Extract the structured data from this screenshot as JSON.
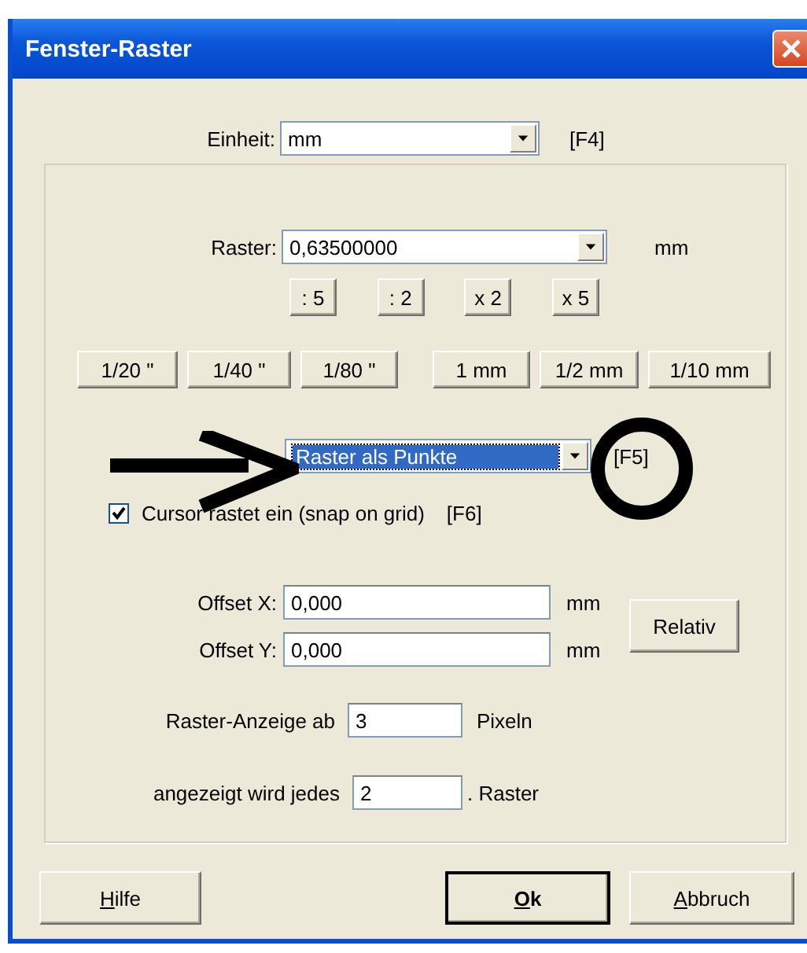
{
  "window": {
    "title": "Fenster-Raster"
  },
  "unit": {
    "label": "Einheit:",
    "value": "mm",
    "shortcut": "[F4]"
  },
  "grid": {
    "label": "Raster:",
    "value": "0,63500000",
    "unit": "mm"
  },
  "factor_buttons": [
    ": 5",
    ": 2",
    "x 2",
    "x 5"
  ],
  "preset_buttons": [
    "1/20 \"",
    "1/40 \"",
    "1/80 \"",
    "1 mm",
    "1/2 mm",
    "1/10 mm"
  ],
  "display_mode": {
    "value": "Raster als Punkte",
    "highlighted": true,
    "shortcut": "[F5]"
  },
  "snap": {
    "label": "Cursor rastet ein (snap on grid)",
    "checked": true,
    "shortcut": "[F6]"
  },
  "offsets": [
    {
      "label": "Offset X:",
      "value": "0,000",
      "unit": "mm"
    },
    {
      "label": "Offset Y:",
      "value": "0,000",
      "unit": "mm"
    }
  ],
  "relative_button": "Relativ",
  "display_from": {
    "label": "Raster-Anzeige ab",
    "value": "3",
    "unit": "Pixeln"
  },
  "show_every": {
    "label": "angezeigt wird jedes",
    "value": "2",
    "unit": ". Raster"
  },
  "buttons": [
    {
      "label": "Hilfe",
      "first_letter_underlined": true,
      "default": false
    },
    {
      "label": "Ok",
      "first_letter_underlined": true,
      "default": true
    },
    {
      "label": "Abbruch",
      "first_letter_underlined": true,
      "default": false
    }
  ]
}
